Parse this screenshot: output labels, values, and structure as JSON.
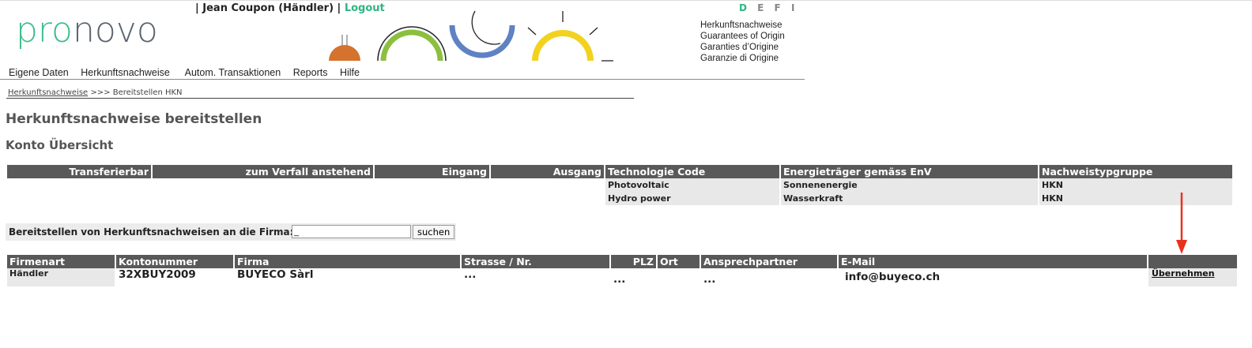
{
  "brand": {
    "part1": "pro",
    "part2": "novo"
  },
  "user": {
    "prefix": "| ",
    "name": "Jean Coupon (Händler)",
    "separator": " | ",
    "logout": "Logout"
  },
  "languages": [
    {
      "code": "D",
      "active": true
    },
    {
      "code": "E",
      "active": false
    },
    {
      "code": "F",
      "active": false
    },
    {
      "code": "I",
      "active": false
    }
  ],
  "hkn_labels": [
    "Herkunftsnachweise",
    "Guarantees of Origin",
    "Garanties d’Origine",
    "Garanzie di Origine"
  ],
  "menu": [
    "Eigene Daten",
    "Herkunftsnachweise",
    "Autom. Transaktionen",
    "Reports",
    "Hilfe"
  ],
  "breadcrumb": {
    "link": "Herkunftsnachweise",
    "sep": " >>> ",
    "current": "Bereitstellen HKN"
  },
  "page_title": "Herkunftsnachweise bereitstellen",
  "section_title": "Konto Übersicht",
  "overview": {
    "headers": [
      "Transferierbar",
      "zum Verfall anstehend",
      "Eingang",
      "Ausgang",
      "Technologie Code",
      "Energieträger gemäss EnV",
      "Nachweistypgruppe"
    ],
    "rows": [
      {
        "tech": "Photovoltaic",
        "energy": "Sonnenenergie",
        "group": "HKN"
      },
      {
        "tech": "Hydro power",
        "energy": "Wasserkraft",
        "group": "HKN"
      }
    ]
  },
  "search": {
    "label": "Bereitstellen von Herkunftsnachweisen an die Firma:",
    "value": "_",
    "button": "suchen"
  },
  "results": {
    "headers": [
      "Firmenart",
      "Kontonummer",
      "Firma",
      "Strasse / Nr.",
      "PLZ",
      "Ort",
      "Ansprechpartner",
      "E-Mail",
      ""
    ],
    "row": {
      "firmenart": "Händler",
      "konto": "32XBUY2009",
      "firma": "BUYECO Sàrl",
      "strasse": "...",
      "plz": "...",
      "ort": "",
      "ansprech": "...",
      "email": "info@buyeco.ch",
      "action": "Übernehmen"
    }
  },
  "colors": {
    "accent": "#2eb582",
    "header_bg": "#595959",
    "arrow": "#e8321e"
  }
}
